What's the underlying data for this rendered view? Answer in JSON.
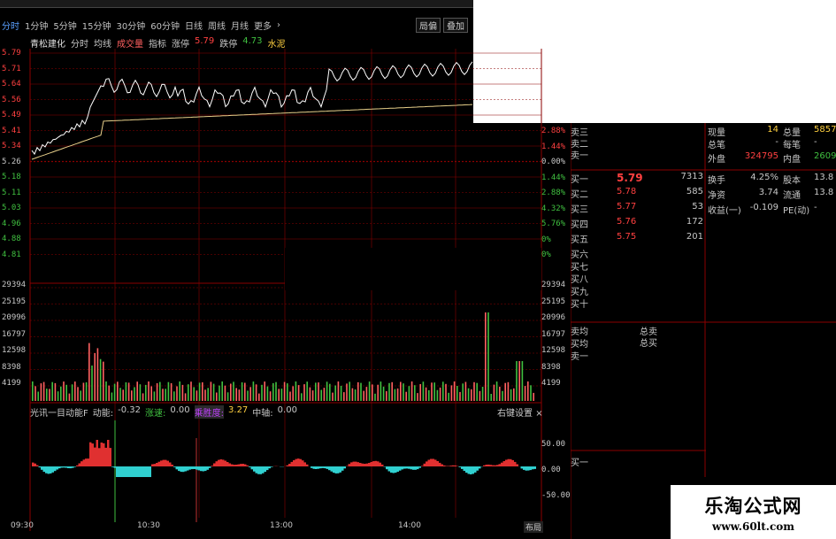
{
  "tabs": {
    "active": "分时",
    "items": [
      "1分钟",
      "5分钟",
      "15分钟",
      "30分钟",
      "60分钟",
      "日线",
      "周线",
      "月线",
      "更多"
    ],
    "more_arrow": "›",
    "buttons": [
      "局偏",
      "叠加"
    ]
  },
  "stock": {
    "name": "青松建化",
    "labels": [
      "分时",
      "均线",
      "成交量",
      "指标",
      "涨停"
    ],
    "limit_up": "5.79",
    "limit_down_label": "跌停",
    "limit_down": "4.73",
    "sector": "水泥"
  },
  "price_axis": [
    "5.79",
    "5.71",
    "5.64",
    "5.56",
    "5.49",
    "5.41",
    "5.34",
    "5.26",
    "5.18",
    "5.11",
    "5.03",
    "4.96",
    "4.88",
    "4.81"
  ],
  "pct_axis": [
    "2.88%",
    "1.44%",
    "0.00%",
    "1.44%",
    "2.88%",
    "4.32%",
    "5.76%",
    "0%",
    "0%"
  ],
  "volume_axis": [
    "29394",
    "25195",
    "20996",
    "16797",
    "12598",
    "8398",
    "4199"
  ],
  "indicator": {
    "name": "光讯一目动能F",
    "items": [
      {
        "label": "动能:",
        "value": "-0.32"
      },
      {
        "label": "涨速:",
        "value": "0.00"
      },
      {
        "label": "乘胜度:",
        "value": "3.27"
      },
      {
        "label": "中轴:",
        "value": "0.00"
      }
    ],
    "axis": [
      "50.00",
      "0.00",
      "-50.00"
    ],
    "settings": "右键设置",
    "close": "×"
  },
  "time_axis": [
    "09:30",
    "10:30",
    "13:00",
    "14:00",
    "布局"
  ],
  "order_book": {
    "top_labels": [
      "卖三",
      "卖二",
      "卖一"
    ],
    "buy_rows": [
      {
        "label": "买一",
        "price": "5.79",
        "vol": "7313"
      },
      {
        "label": "买二",
        "price": "5.78",
        "vol": "585"
      },
      {
        "label": "买三",
        "price": "5.77",
        "vol": "53"
      },
      {
        "label": "买四",
        "price": "5.76",
        "vol": "172"
      },
      {
        "label": "买五",
        "price": "5.75",
        "vol": "201"
      }
    ],
    "more_labels": [
      "买六",
      "买七",
      "买八",
      "买九",
      "买十"
    ],
    "avg_labels": [
      "卖均",
      "买均",
      "卖一"
    ],
    "totals": [
      "总卖",
      "总买"
    ],
    "bottom_label": "买一"
  },
  "stats": {
    "top": [
      {
        "l1": "现量",
        "v1": "14",
        "l2": "总量",
        "v2": "5857"
      },
      {
        "l1": "总笔",
        "v1": "-",
        "l2": "每笔",
        "v2": "-"
      },
      {
        "l1": "外盘",
        "v1": "324795",
        "l2": "内盘",
        "v2": "2609"
      }
    ],
    "bottom": [
      {
        "l1": "换手",
        "v1": "4.25%",
        "l2": "股本",
        "v2": "13.8"
      },
      {
        "l1": "净资",
        "v1": "3.74",
        "l2": "流通",
        "v2": "13.8"
      },
      {
        "l1": "收益(一)",
        "v1": "-0.109",
        "l2": "PE(动)",
        "v2": "-"
      }
    ]
  },
  "watermark": {
    "title": "乐淘公式网",
    "url": "www.60lt.com"
  },
  "colors": {
    "up": "#ff4040",
    "down": "#30d0d0",
    "green": "#40c040",
    "grid": "#8b0000",
    "avg": "#e8d08a",
    "yellow": "#ffd040",
    "violet": "#c040ff"
  }
}
